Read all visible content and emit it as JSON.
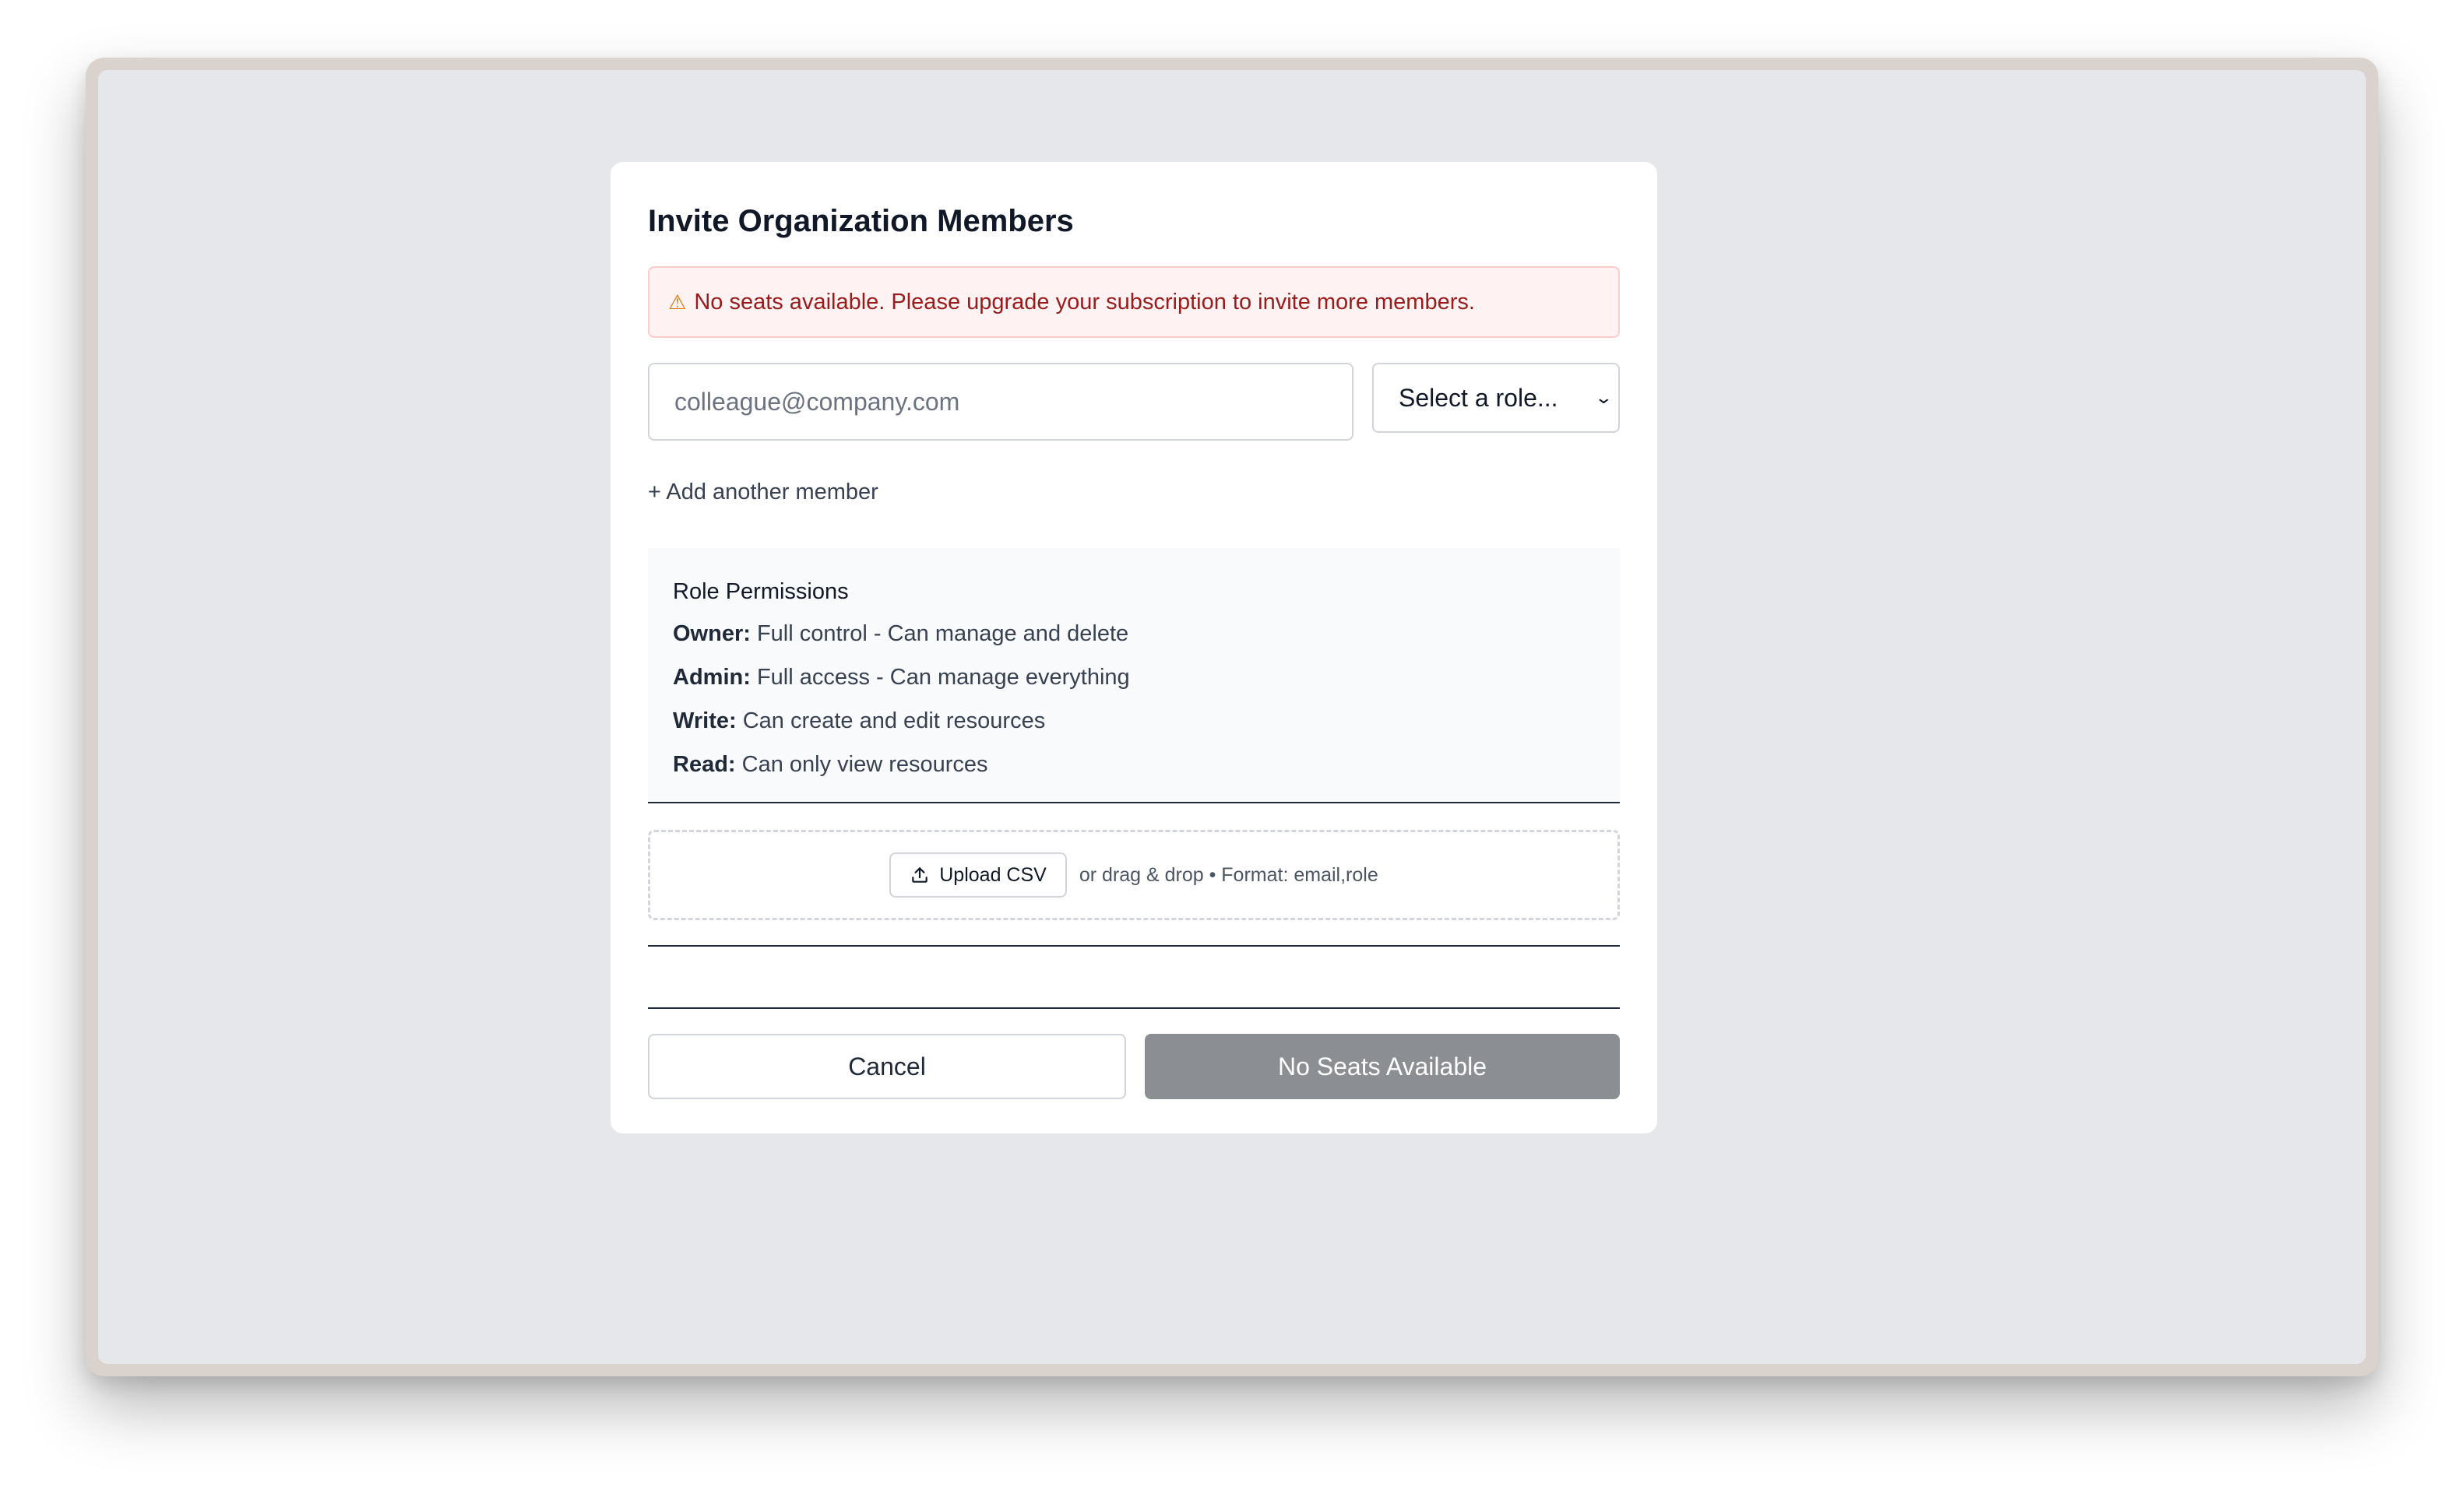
{
  "modal": {
    "title": "Invite Organization Members",
    "alert": {
      "icon": "warning-icon",
      "text": "No seats available. Please upgrade your subscription to invite more members."
    },
    "email_input": {
      "placeholder": "colleague@company.com",
      "value": ""
    },
    "role_select": {
      "selected": "Select a role..."
    },
    "add_member_label": "+ Add another member",
    "permissions": {
      "title": "Role Permissions",
      "items": [
        {
          "role": "Owner:",
          "desc": "Full control - Can manage and delete"
        },
        {
          "role": "Admin:",
          "desc": "Full access - Can manage everything"
        },
        {
          "role": "Write:",
          "desc": "Can create and edit resources"
        },
        {
          "role": "Read:",
          "desc": "Can only view resources"
        }
      ]
    },
    "upload": {
      "button_label": "Upload CSV",
      "hint": "or drag & drop • Format: email,role"
    },
    "actions": {
      "cancel_label": "Cancel",
      "submit_label": "No Seats Available"
    }
  },
  "colors": {
    "backdrop": "#e5e7eb",
    "alert_bg": "#fef2f2",
    "alert_text": "#991b1b",
    "submit_disabled": "#8b8e93"
  }
}
